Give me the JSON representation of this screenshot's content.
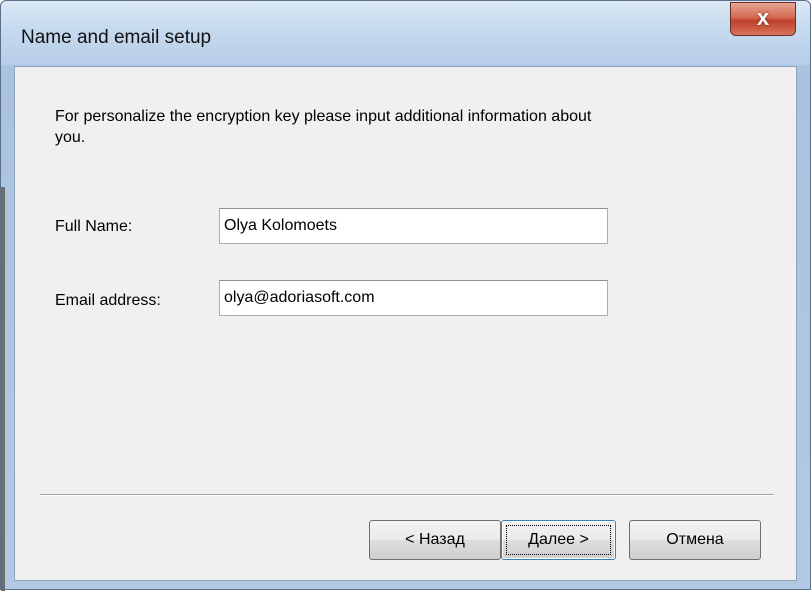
{
  "window": {
    "title": "Name and email setup",
    "close_label": "x"
  },
  "main": {
    "intro_text": "For personalize the encryption key please input additional information about you.",
    "full_name_label": "Full Name:",
    "full_name_value": "Olya Kolomoets",
    "email_label": "Email address:",
    "email_value": "olya@adoriasoft.com"
  },
  "buttons": {
    "back_label": "< Назад",
    "next_label": "Далее >",
    "cancel_label": "Отмена"
  }
}
